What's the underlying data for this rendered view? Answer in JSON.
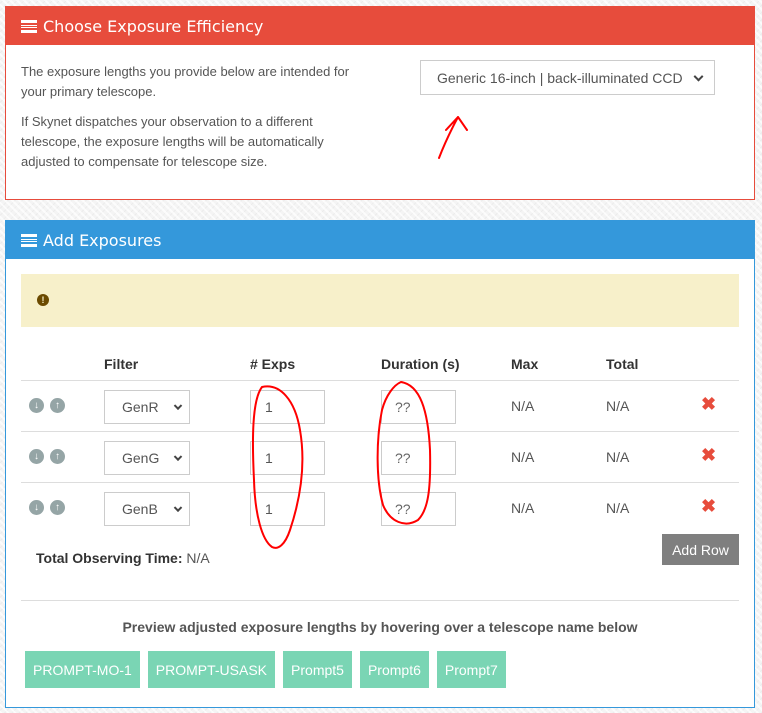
{
  "efficiency_panel": {
    "title": "Choose Exposure Efficiency",
    "title_icon": "table-list-icon",
    "paragraph1": "The exposure lengths you provide below are intended for your primary telescope.",
    "paragraph2": "If Skynet dispatches your observation to a different telescope, the exposure lengths will be automatically adjusted to compensate for telescope size.",
    "telescope_select": {
      "value": "Generic 16-inch | back-illuminated CCD"
    }
  },
  "exposures_panel": {
    "title": "Add Exposures",
    "title_icon": "table-list-icon",
    "alert": {
      "icon": "exclamation-circle-icon",
      "text": ""
    },
    "columns": [
      "Filter",
      "# Exps",
      "Duration (s)",
      "Max",
      "Total"
    ],
    "rows": [
      {
        "filter": "GenR",
        "exps": "1",
        "duration": "??",
        "max": "N/A",
        "total": "N/A"
      },
      {
        "filter": "GenG",
        "exps": "1",
        "duration": "??",
        "max": "N/A",
        "total": "N/A"
      },
      {
        "filter": "GenB",
        "exps": "1",
        "duration": "??",
        "max": "N/A",
        "total": "N/A"
      }
    ],
    "row_controls": {
      "move_down": "arrow-circle-down-icon",
      "move_up": "arrow-circle-up-icon",
      "delete": "times-icon"
    },
    "total_label": "Total Observing Time:",
    "total_value": "N/A",
    "add_row_label": "Add Row",
    "preview_text": "Preview adjusted exposure lengths by hovering over a telescope name below",
    "telescopes": [
      "PROMPT-MO-1",
      "PROMPT-USASK",
      "Prompt5",
      "Prompt6",
      "Prompt7"
    ]
  },
  "colors": {
    "danger": "#e74c3c",
    "primary": "#3498db",
    "alert_bg": "#f7f0ca",
    "telescope_btn": "#7ad5b4",
    "add_row_btn": "#7f7f7f",
    "annotation": "#ff0000"
  }
}
